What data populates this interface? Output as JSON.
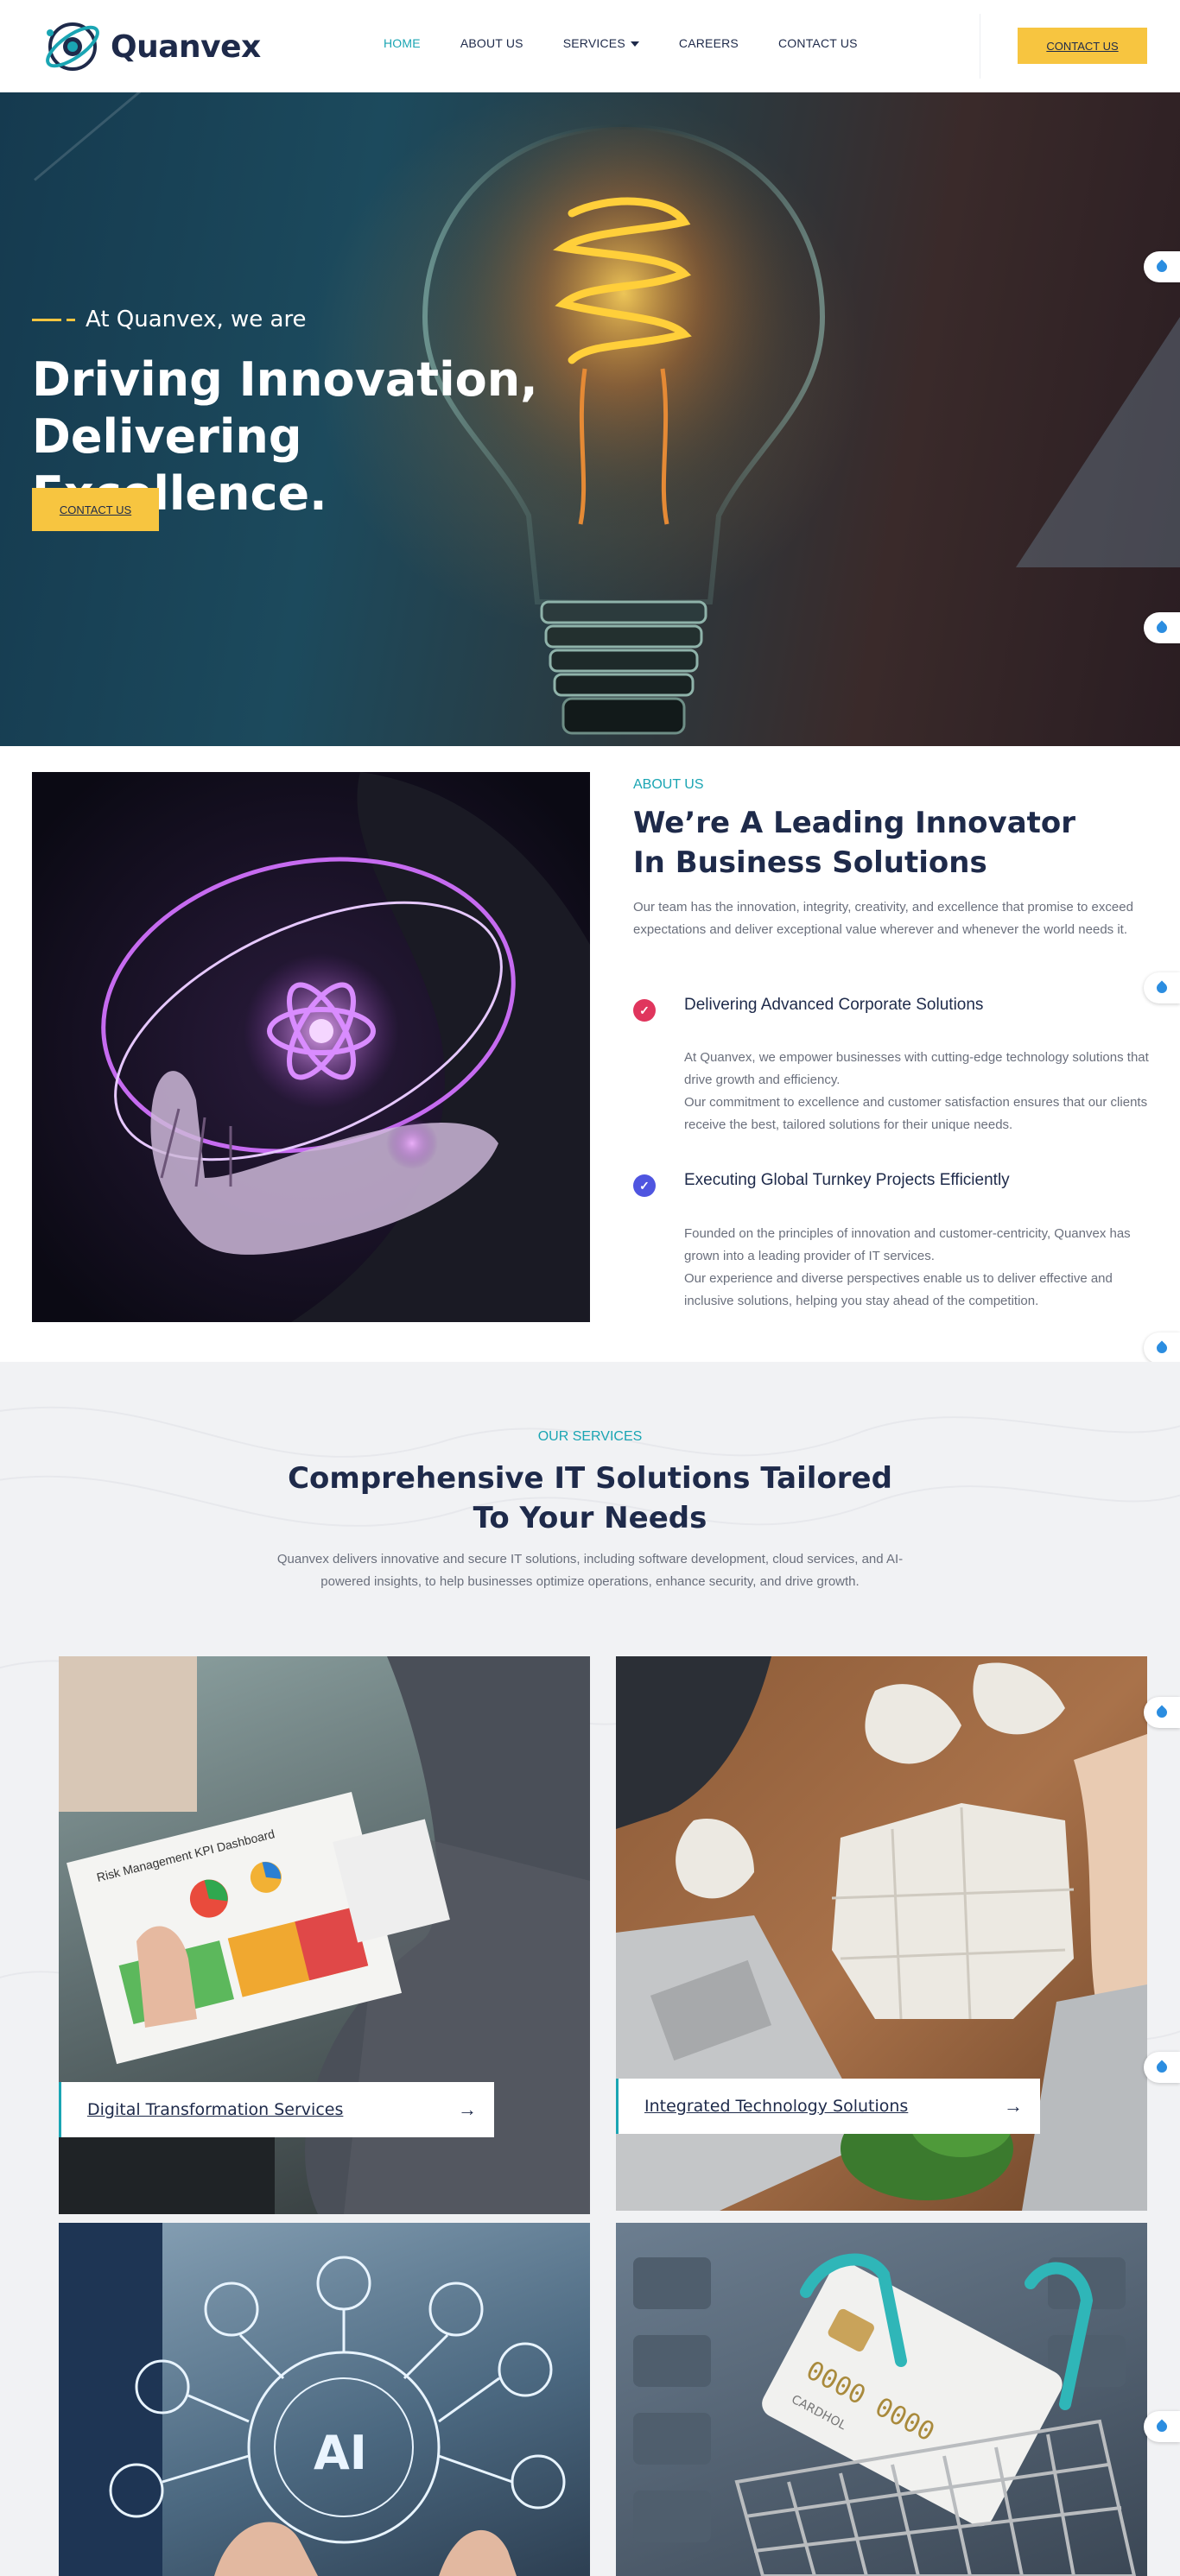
{
  "brand": {
    "name": "Quanvex",
    "accent": "#1aa5b3",
    "button_color": "#f7c540",
    "dark_text": "#1e2a4a"
  },
  "nav": {
    "items": [
      {
        "label": "HOME",
        "active": true
      },
      {
        "label": "ABOUT US",
        "active": false
      },
      {
        "label": "SERVICES",
        "active": false
      },
      {
        "label": "CAREERS",
        "active": false
      },
      {
        "label": "CONTACT US",
        "active": false
      }
    ],
    "cta_label": "CONTACT US"
  },
  "hero": {
    "eyebrow": "At Quanvex, we are",
    "title_line1": "Driving Innovation,",
    "title_line2": "Delivering Excellence.",
    "cta_label": "CONTACT US"
  },
  "about": {
    "eyebrow": "ABOUT US",
    "title": "We’re A Leading Innovator In Business Solutions",
    "description": "Our team has the innovation, integrity, creativity, and excellence that promise to exceed expectations and deliver exceptional value wherever and whenever the world needs it.",
    "features": [
      {
        "title": "Delivering Advanced Corporate Solutions",
        "icon": "check-icon",
        "color": "#e0355d",
        "text1": "At Quanvex, we empower businesses with cutting-edge technology solutions that drive growth and efficiency.",
        "text2": "Our commitment to excellence and customer satisfaction ensures that our clients receive the best, tailored solutions for their unique needs."
      },
      {
        "title": "Executing Global Turnkey Projects Efficiently",
        "icon": "check-icon",
        "color": "#4f55e0",
        "text1": "Founded on the principles of innovation and customer-centricity, Quanvex has grown into a leading provider of IT services.",
        "text2": "Our experience and diverse perspectives enable us to deliver effective and inclusive solutions, helping you stay ahead of the competition."
      }
    ]
  },
  "services": {
    "eyebrow": "OUR SERVICES",
    "title_line1": "Comprehensive IT Solutions Tailored",
    "title_line2": "To Your Needs",
    "description": "Quanvex delivers innovative and secure IT solutions, including software development, cloud services, and AI-powered insights, to help businesses optimize operations, enhance security, and drive growth.",
    "cards": [
      {
        "title": "Digital Transformation Services",
        "image": "kpi-dashboard-photo"
      },
      {
        "title": "Integrated Technology Solutions",
        "image": "puzzle-laptop-photo"
      },
      {
        "title": "",
        "image": "ai-hologram-photo"
      },
      {
        "title": "",
        "image": "credit-card-cart-photo"
      }
    ]
  },
  "card_image_labels": {
    "kpi_report": "Risk Management KPI Dashboard",
    "ai": "AI",
    "card_text": "CARDHOL"
  }
}
